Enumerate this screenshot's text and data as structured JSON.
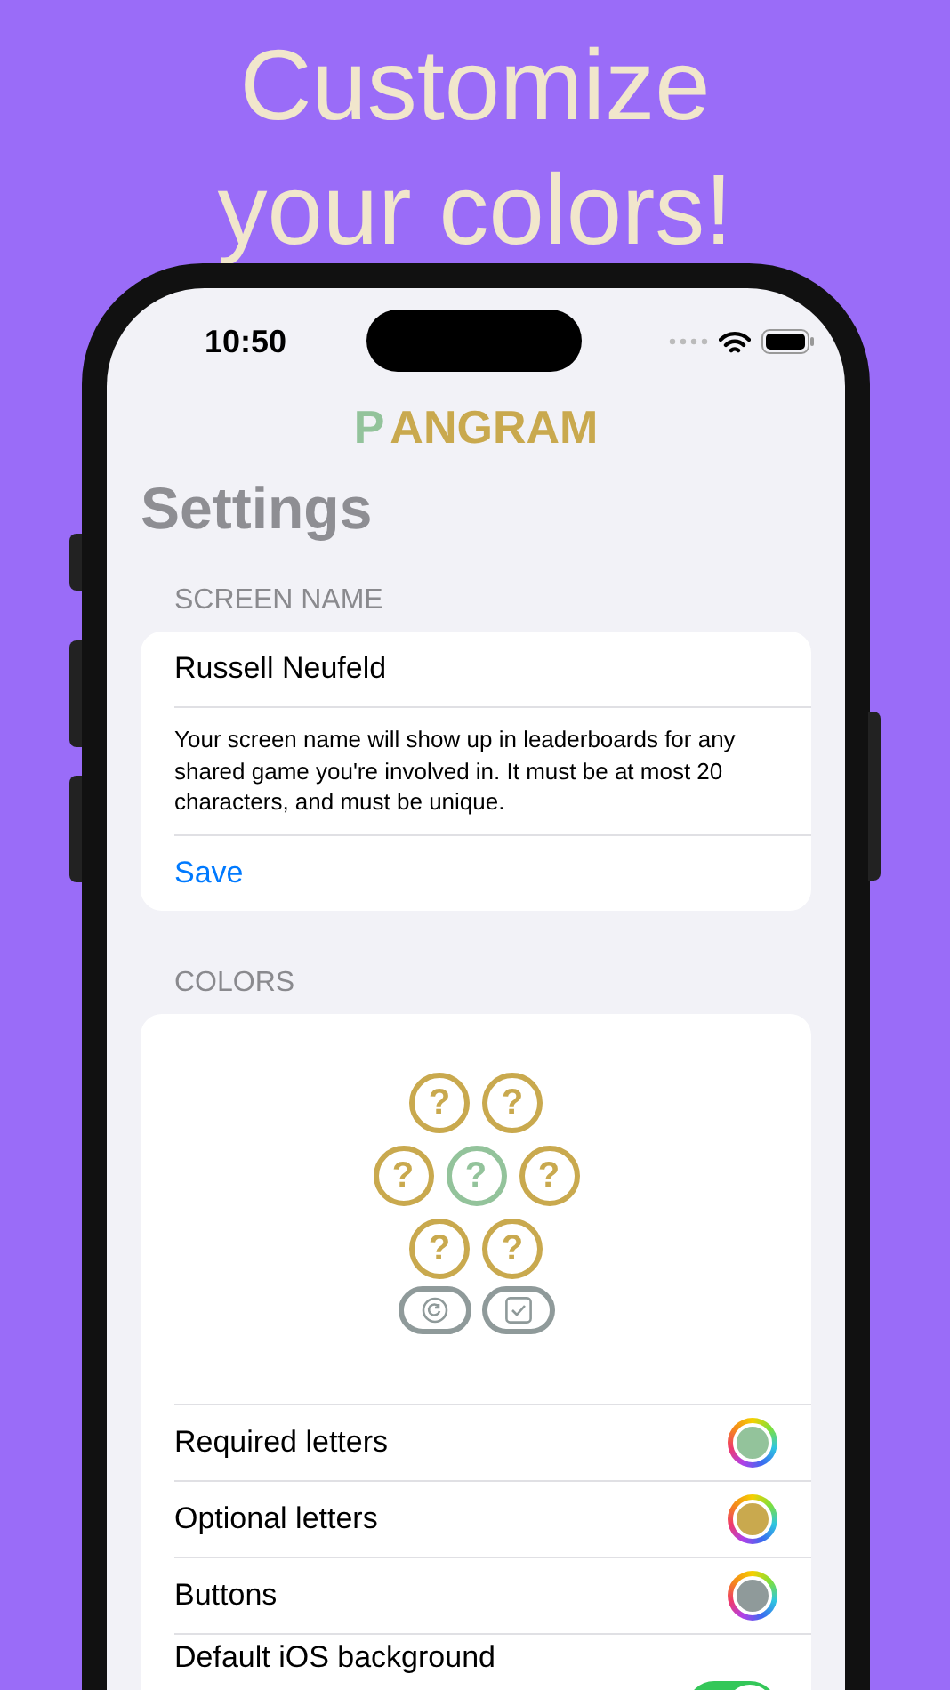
{
  "headline": [
    "Customize",
    "your colors!"
  ],
  "status_bar": {
    "time": "10:50"
  },
  "app_title": {
    "first": "P",
    "rest": "ANGRAM"
  },
  "page_title": "Settings",
  "screen_name": {
    "header": "SCREEN NAME",
    "value": "Russell Neufeld",
    "description": "Your screen name will show up in leaderboards for any shared game you're involved in. It must be at most 20 characters, and must be unique.",
    "save": "Save"
  },
  "colors": {
    "header": "COLORS",
    "preview": {
      "rows": [
        [
          {
            "text": "?",
            "kind": "optional"
          },
          {
            "text": "?",
            "kind": "optional"
          }
        ],
        [
          {
            "text": "?",
            "kind": "optional"
          },
          {
            "text": "?",
            "kind": "required"
          },
          {
            "text": "?",
            "kind": "optional"
          }
        ],
        [
          {
            "text": "?",
            "kind": "optional"
          },
          {
            "text": "?",
            "kind": "optional"
          }
        ]
      ],
      "buttons": [
        {
          "kind": "refresh"
        },
        {
          "kind": "check"
        }
      ]
    },
    "rows": [
      {
        "label": "Required letters",
        "kind": "color",
        "color": "#93c39b"
      },
      {
        "label": "Optional letters",
        "kind": "color",
        "color": "#c9a94e"
      },
      {
        "label": "Buttons",
        "kind": "color",
        "color": "#8f9a9a"
      },
      {
        "label": "Default iOS background",
        "kind": "toggle",
        "on": true
      }
    ]
  }
}
